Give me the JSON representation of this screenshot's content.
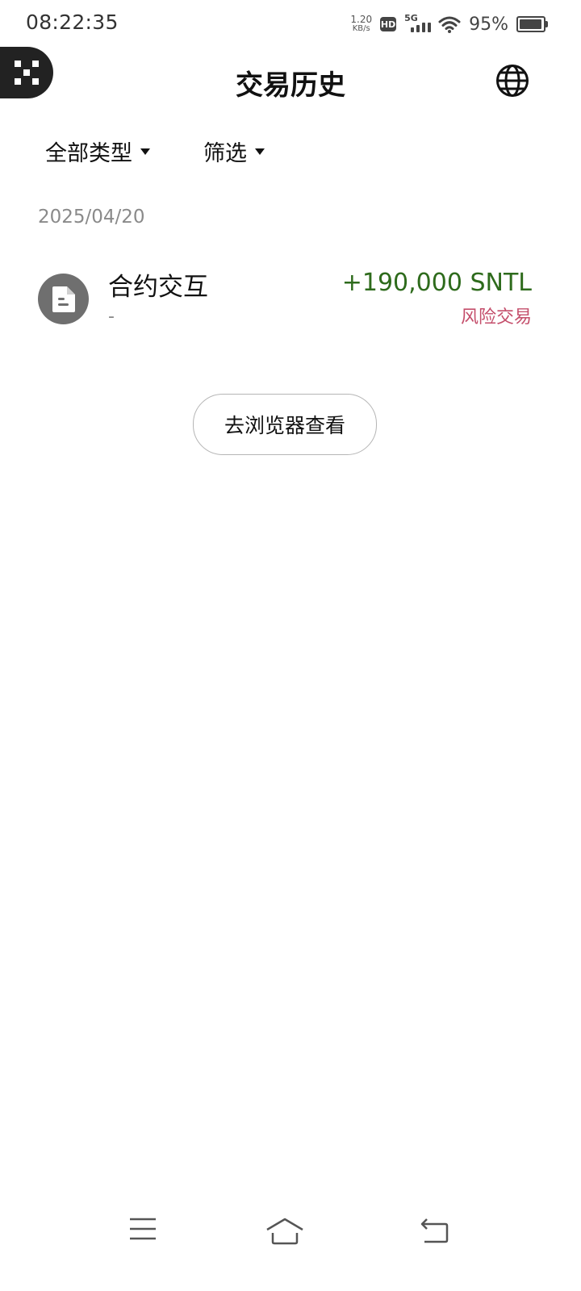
{
  "status_bar": {
    "time": "08:22:35",
    "net_speed_value": "1.20",
    "net_speed_unit": "KB/s",
    "hd_label": "HD",
    "network_label": "5G",
    "battery_percent_text": "95%",
    "battery_level": 0.95,
    "icons": [
      "hd-icon",
      "signal-icon",
      "wifi-icon",
      "battery-icon"
    ]
  },
  "header": {
    "title": "交易历史",
    "left_badge_icon": "grid-logo-icon",
    "right_icon": "globe-icon"
  },
  "filters": {
    "type_label": "全部类型",
    "filter_label": "筛选",
    "caret_icon": "caret-down-icon"
  },
  "transactions": {
    "date": "2025/04/20",
    "items": [
      {
        "title": "合约交互",
        "subtitle": "-",
        "amount": "+190,000 SNTL",
        "tag": "风险交易",
        "icon": "document-icon"
      }
    ]
  },
  "actions": {
    "view_in_browser": "去浏览器查看"
  },
  "nav_bar": {
    "icons": [
      "menu-icon",
      "home-icon",
      "back-icon"
    ]
  },
  "colors": {
    "amount_positive": "#2e6b1c",
    "risk_tag": "#c44e6b",
    "date_gray": "#8a8a8a",
    "avatar_gray": "#6f6f6f"
  }
}
